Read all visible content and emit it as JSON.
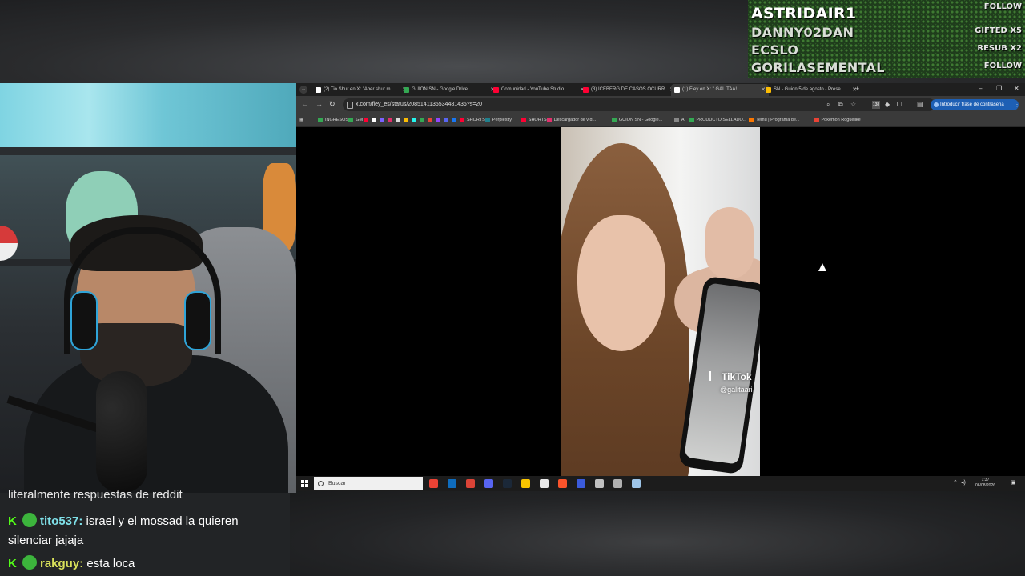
{
  "alerts": [
    {
      "name": "ASTRIDAIR1",
      "tag": "FOLLOW"
    },
    {
      "name": "DANNY02DAN",
      "tag": "GIFTED X5"
    },
    {
      "name": "ECSLO",
      "tag": "RESUB X2"
    },
    {
      "name": "GORILASEMENTAL",
      "tag": "FOLLOW"
    }
  ],
  "chat": {
    "cut_line": "literalmente respuestas de reddit",
    "messages": [
      {
        "badge": "K",
        "user": "tito537:",
        "text": " israel y el mossad la quieren silenciar jajaja"
      },
      {
        "badge": "K",
        "user": "rakguy:",
        "text": " esta loca"
      }
    ]
  },
  "browser": {
    "tabs": [
      {
        "label": "(2) Tio Shur en X: \"Aber shur m",
        "icon": "x-icon",
        "color": "#ffffff",
        "active": false
      },
      {
        "label": "GUION SN - Google Drive",
        "icon": "drive-icon",
        "color": "#34a853",
        "active": false
      },
      {
        "label": "Comunidad - YouTube Studio",
        "icon": "youtube-studio-icon",
        "color": "#ff0033",
        "active": false
      },
      {
        "label": "(3) ICEBERG DE CASOS OCURR",
        "icon": "youtube-icon",
        "color": "#ff0033",
        "active": false
      },
      {
        "label": "(1) Fley en X: \" GALITAA!",
        "icon": "x-icon",
        "color": "#ffffff",
        "active": true
      },
      {
        "label": "SN - Guion 5 de agosto - Prese",
        "icon": "slides-icon",
        "color": "#fbbc04",
        "active": false
      }
    ],
    "new_tab": "+",
    "window_controls": {
      "minimize": "–",
      "maximize": "❐",
      "close": "✕"
    },
    "url": "x.com/fley_es/status/2085141135534481436?s=20",
    "extension_badge": "138",
    "password_button": "Introducir frase de contraseña",
    "bookmarks": [
      {
        "label": "INGRESOS",
        "color": "#34a853"
      },
      {
        "label": "GM",
        "color": "#34a853"
      },
      {
        "label": "",
        "color": "#ff0033"
      },
      {
        "label": "",
        "color": "#ffffff"
      },
      {
        "label": "",
        "color": "#7b61ff"
      },
      {
        "label": "",
        "color": "#e1306c"
      },
      {
        "label": "",
        "color": "#dddddd"
      },
      {
        "label": "",
        "color": "#fbbc04"
      },
      {
        "label": "",
        "color": "#25f4ee"
      },
      {
        "label": "",
        "color": "#34a853"
      },
      {
        "label": "",
        "color": "#ea4335"
      },
      {
        "label": "",
        "color": "#9146ff"
      },
      {
        "label": "",
        "color": "#5865f2"
      },
      {
        "label": "",
        "color": "#1877f2"
      },
      {
        "label": "SHORTS",
        "color": "#ff0033"
      },
      {
        "label": "Perplexity",
        "color": "#20808d"
      },
      {
        "label": "SHORTS",
        "color": "#ff0033"
      },
      {
        "label": "Descargador de víd...",
        "color": "#e1306c"
      },
      {
        "label": "GUION SN - Google...",
        "color": "#34a853"
      },
      {
        "label": "AI",
        "color": "#888888"
      },
      {
        "label": "PRODUCTO SELLADO...",
        "color": "#34a853"
      },
      {
        "label": "Temu | Programa de...",
        "color": "#fb7701"
      },
      {
        "label": "Pokemon Roguelike",
        "color": "#ea4335"
      }
    ],
    "video": {
      "brand": "TikTok",
      "handle": "@galitaari"
    }
  },
  "taskbar": {
    "search_placeholder": "Buscar",
    "apps": [
      {
        "icon": "chrome-icon",
        "color": "#ea4335"
      },
      {
        "icon": "outlook-icon",
        "color": "#0f6cbd"
      },
      {
        "icon": "chrome-profile-icon",
        "color": "#db4437"
      },
      {
        "icon": "discord-icon",
        "color": "#5865f2"
      },
      {
        "icon": "steam-icon",
        "color": "#1b2838"
      },
      {
        "icon": "file-explorer-icon",
        "color": "#f8c400"
      },
      {
        "icon": "notepad-icon",
        "color": "#e8e8e8"
      },
      {
        "icon": "brave-icon",
        "color": "#fb542b"
      },
      {
        "icon": "app-icon",
        "color": "#3b5bdb"
      },
      {
        "icon": "app-icon",
        "color": "#c0c0c0"
      },
      {
        "icon": "app-icon",
        "color": "#b0b0b0"
      },
      {
        "icon": "app-icon",
        "color": "#9ec5e8"
      }
    ],
    "time": "1:37",
    "date": "06/08/2026"
  }
}
